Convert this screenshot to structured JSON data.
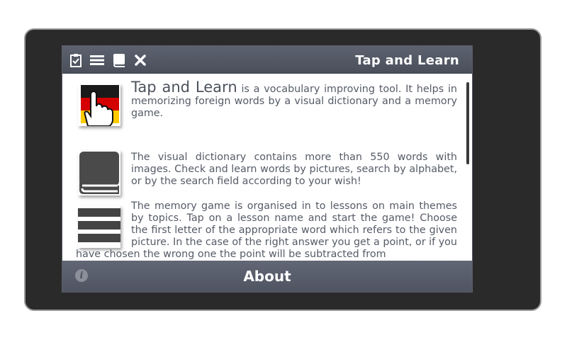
{
  "header": {
    "title": "Tap and Learn",
    "icons": [
      "clipboard-check-icon",
      "list-icon",
      "book-icon",
      "close-icon"
    ]
  },
  "content": {
    "intro": {
      "title": "Tap and Learn",
      "text": " is a vocabulary improving tool. It helps in memorizing foreign words by a visual dictionary and a memory game."
    },
    "dictionary": "The visual dictionary contains more than 550 words with images. Check and learn words by pictures, search by alphabet, or by the search field according to your wish!",
    "memory_game": "The memory game is organised in to lessons on main themes by topics. Tap on a lesson name and start the game! Choose the first letter of the appropriate word which refers to the given picture. In the case of the right answer you get a point, or if you have chosen the wrong one the point will be subtracted from"
  },
  "footer": {
    "title": "About",
    "info_icon": "i"
  },
  "colors": {
    "bar": "#555a66",
    "text": "#555b66",
    "device": "#2a2a2a"
  }
}
